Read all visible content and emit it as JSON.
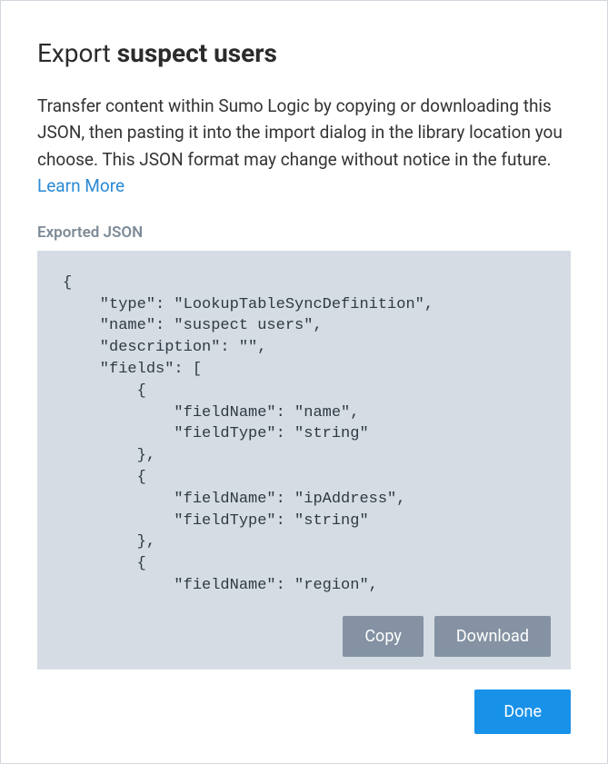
{
  "dialog": {
    "title_prefix": "Export ",
    "title_bold": "suspect users",
    "description_text": "Transfer content within Sumo Logic by copying or downloading this JSON, then pasting it into the import dialog in the library location you choose. This JSON format may change without notice in the future. ",
    "learn_more": "Learn More",
    "section_label": "Exported JSON",
    "code_text": "{\n    \"type\": \"LookupTableSyncDefinition\",\n    \"name\": \"suspect users\",\n    \"description\": \"\",\n    \"fields\": [\n        {\n            \"fieldName\": \"name\",\n            \"fieldType\": \"string\"\n        },\n        {\n            \"fieldName\": \"ipAddress\",\n            \"fieldType\": \"string\"\n        },\n        {\n            \"fieldName\": \"region\",",
    "copy_label": "Copy",
    "download_label": "Download",
    "done_label": "Done"
  }
}
